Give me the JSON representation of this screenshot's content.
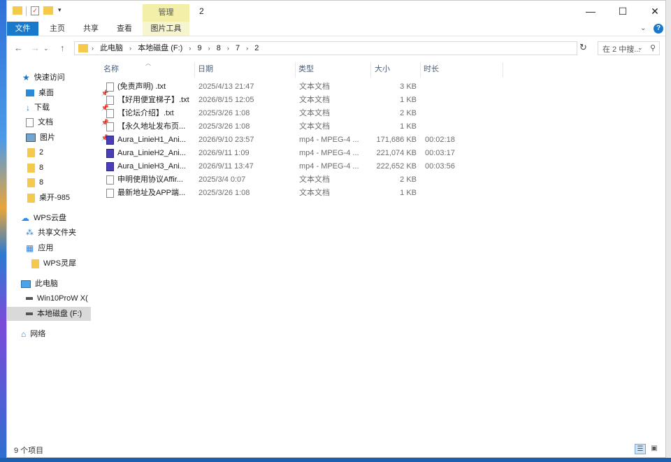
{
  "window": {
    "title": "2",
    "manage_label": "管理",
    "controls": {
      "minimize": "—",
      "maximize": "☐",
      "close": "✕"
    }
  },
  "ribbon": {
    "tabs": [
      "文件",
      "主页",
      "共享",
      "查看",
      "图片工具"
    ],
    "help": "?"
  },
  "address": {
    "crumbs": [
      "此电脑",
      "本地磁盘 (F:)",
      "9",
      "8",
      "7",
      "2"
    ]
  },
  "search": {
    "placeholder": "在 2 中搜..."
  },
  "sidebar": {
    "quick_access": "快速访问",
    "quick_items": [
      "桌面",
      "下载",
      "文档",
      "图片",
      "2",
      "8",
      "8",
      "桌开-985"
    ],
    "wps_cloud": "WPS云盘",
    "shared_folder": "共享文件夹",
    "apps": "应用",
    "wps_ling": "WPS灵犀",
    "this_pc": "此电脑",
    "drive_c": "Win10ProW X(",
    "drive_f": "本地磁盘 (F:)",
    "network": "网络"
  },
  "columns": {
    "name": "名称",
    "date": "日期",
    "type": "类型",
    "size": "大小",
    "duration": "时长"
  },
  "files": [
    {
      "name": "(免责声明) .txt",
      "date": "2025/4/13 21:47",
      "type": "文本文档",
      "size": "3 KB",
      "duration": "",
      "kind": "txt"
    },
    {
      "name": "【好用便宜梯子】.txt",
      "date": "2026/8/15 12:05",
      "type": "文本文档",
      "size": "1 KB",
      "duration": "",
      "kind": "txt"
    },
    {
      "name": "【论坛介绍】.txt",
      "date": "2025/3/26 1:08",
      "type": "文本文档",
      "size": "2 KB",
      "duration": "",
      "kind": "txt"
    },
    {
      "name": "【永久地址发布页...",
      "date": "2025/3/26 1:08",
      "type": "文本文档",
      "size": "1 KB",
      "duration": "",
      "kind": "txt"
    },
    {
      "name": "Aura_LinieH1_Ani...",
      "date": "2026/9/10 23:57",
      "type": "mp4 - MPEG-4 ...",
      "size": "171,686 KB",
      "duration": "00:02:18",
      "kind": "video"
    },
    {
      "name": "Aura_LinieH2_Ani...",
      "date": "2026/9/11 1:09",
      "type": "mp4 - MPEG-4 ...",
      "size": "221,074 KB",
      "duration": "00:03:17",
      "kind": "video"
    },
    {
      "name": "Aura_LinieH3_Ani...",
      "date": "2026/9/11 13:47",
      "type": "mp4 - MPEG-4 ...",
      "size": "222,652 KB",
      "duration": "00:03:56",
      "kind": "video"
    },
    {
      "name": "申明使用协议Affir...",
      "date": "2025/3/4 0:07",
      "type": "文本文档",
      "size": "2 KB",
      "duration": "",
      "kind": "txt"
    },
    {
      "name": "最新地址及APP端...",
      "date": "2025/3/26 1:08",
      "type": "文本文档",
      "size": "1 KB",
      "duration": "",
      "kind": "txt"
    }
  ],
  "status": {
    "text": "9 个项目"
  },
  "colors": {
    "accent": "#1979ca",
    "manage_tab": "#f3eea8",
    "folder": "#f5c94c"
  }
}
